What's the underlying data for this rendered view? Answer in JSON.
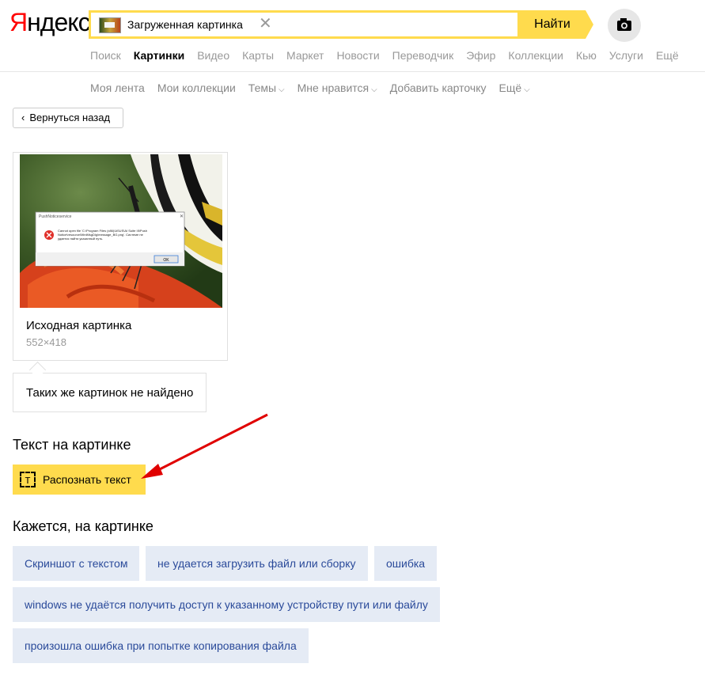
{
  "header": {
    "logo": "Яндекс",
    "search": {
      "query": "Загруженная картинка",
      "clear_icon": "close-icon"
    },
    "find_label": "Найти",
    "camera_icon": "camera-icon"
  },
  "services": [
    "Поиск",
    "Картинки",
    "Видео",
    "Карты",
    "Маркет",
    "Новости",
    "Переводчик",
    "Эфир",
    "Коллекции",
    "Кью",
    "Услуги",
    "Ещё"
  ],
  "active_service": "Картинки",
  "subnav": [
    "Моя лента",
    "Мои коллекции",
    "Темы",
    "Мне нравится",
    "Добавить карточку",
    "Ещё"
  ],
  "back_label": "Вернуться назад",
  "source_card": {
    "title": "Исходная картинка",
    "size": "552×418"
  },
  "screenshot_dialog": {
    "title": "PushNoticeservice",
    "message": "Cannot open file 'C:\\Program Files (x86)\\ASUS\\AI Suite III\\PushNotice\\resource\\MiniMsgDlg\\message_BG.png'. Системе не удается найти указанный путь.",
    "ok": "OK"
  },
  "not_found": "Таких же картинок не найдено",
  "text_section": {
    "title": "Текст на картинке",
    "ocr_label": "Распознать текст"
  },
  "seems_section": {
    "title": "Кажется, на картинке",
    "tags": [
      "Скриншот с текстом",
      "не удается загрузить файл или сборку",
      "ошибка",
      "windows не удаётся получить доступ к указанному устройству пути или файлу",
      "произошла ошибка при попытке копирования файла"
    ]
  },
  "colors": {
    "accent": "#ffdb4d",
    "tag_bg": "#e5ebf5",
    "tag_text": "#2a4a9a",
    "annotation_arrow": "#e00000"
  }
}
